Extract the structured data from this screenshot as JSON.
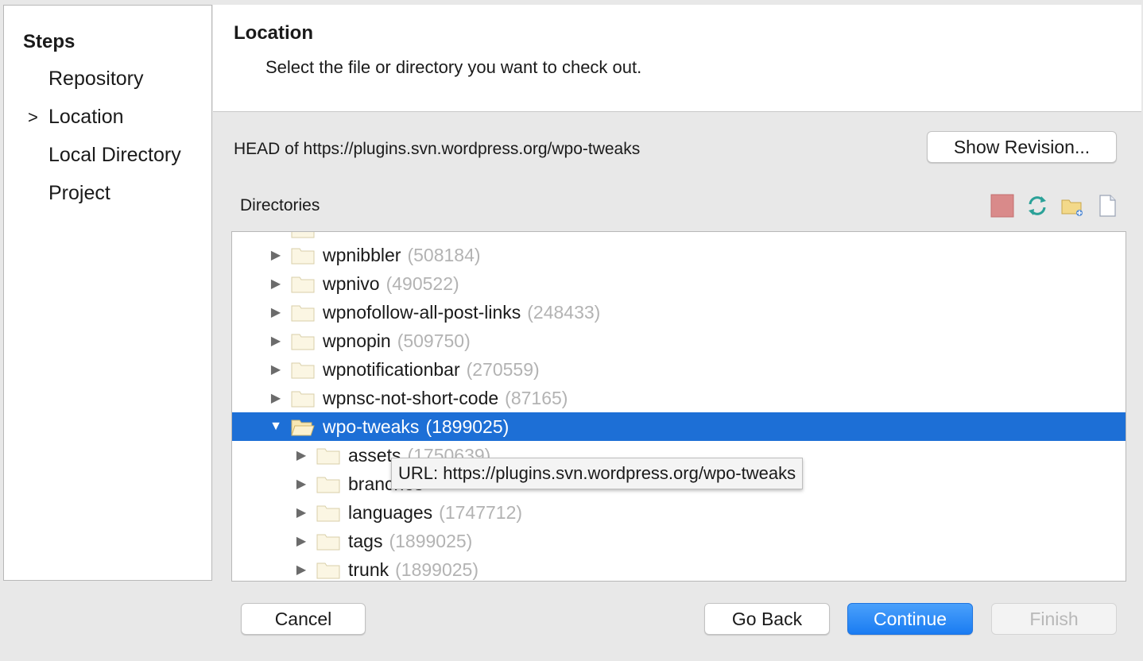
{
  "steps": {
    "title": "Steps",
    "items": [
      {
        "label": "Repository"
      },
      {
        "label": "Location",
        "current": true
      },
      {
        "label": "Local Directory"
      },
      {
        "label": "Project"
      }
    ],
    "current_marker": ">"
  },
  "header": {
    "title": "Location",
    "description": "Select the file or directory you want to check out."
  },
  "head_label": "HEAD of https://plugins.svn.wordpress.org/wpo-tweaks",
  "show_revision_label": "Show Revision...",
  "directories_label": "Directories",
  "toolbar_icons": [
    "stop-icon",
    "refresh-icon",
    "new-folder-icon",
    "new-file-icon"
  ],
  "tree": {
    "rows": [
      {
        "name": "wpnibbler",
        "rev": "(508184)",
        "depth": 0,
        "expanded": false
      },
      {
        "name": "wpnivo",
        "rev": "(490522)",
        "depth": 0,
        "expanded": false
      },
      {
        "name": "wpnofollow-all-post-links",
        "rev": "(248433)",
        "depth": 0,
        "expanded": false
      },
      {
        "name": "wpnopin",
        "rev": "(509750)",
        "depth": 0,
        "expanded": false
      },
      {
        "name": "wpnotificationbar",
        "rev": "(270559)",
        "depth": 0,
        "expanded": false
      },
      {
        "name": "wpnsc-not-short-code",
        "rev": "(87165)",
        "depth": 0,
        "expanded": false
      },
      {
        "name": "wpo-tweaks",
        "rev": "(1899025)",
        "depth": 0,
        "expanded": true,
        "selected": true
      },
      {
        "name": "assets",
        "rev": "(1750639)",
        "depth": 1,
        "expanded": false
      },
      {
        "name": "branches",
        "rev": "",
        "depth": 1,
        "expanded": false
      },
      {
        "name": "languages",
        "rev": "(1747712)",
        "depth": 1,
        "expanded": false
      },
      {
        "name": "tags",
        "rev": "(1899025)",
        "depth": 1,
        "expanded": false
      },
      {
        "name": "trunk",
        "rev": "(1899025)",
        "depth": 1,
        "expanded": false
      }
    ]
  },
  "tooltip": "URL: https://plugins.svn.wordpress.org/wpo-tweaks",
  "buttons": {
    "cancel": "Cancel",
    "go_back": "Go Back",
    "continue": "Continue",
    "finish": "Finish"
  },
  "colors": {
    "selection": "#1d6fd6",
    "primary_button": "#1a7cf2",
    "revision_text": "#b3b3b3"
  }
}
